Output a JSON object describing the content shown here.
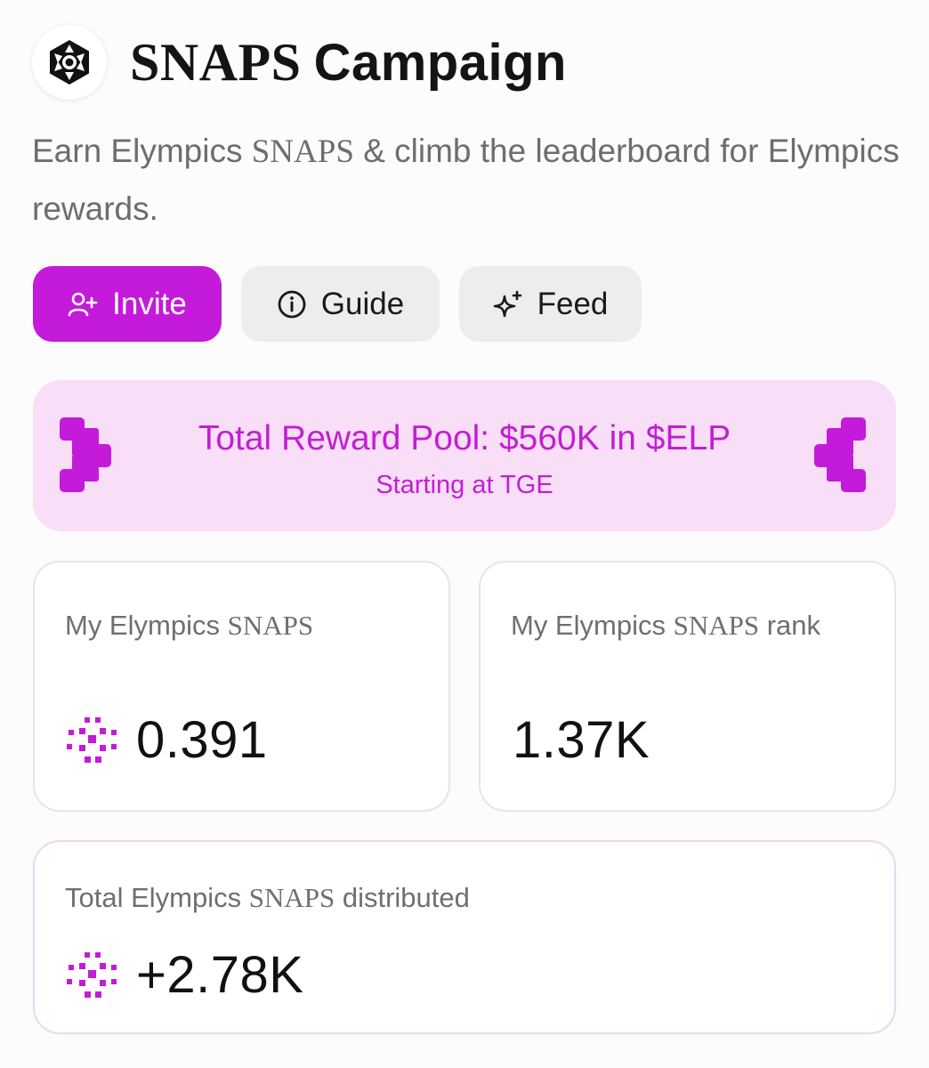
{
  "header": {
    "logo_icon": "elymphics-hex-logo-icon",
    "title_brand": "SNAPS",
    "title_rest": "Campaign"
  },
  "subtitle": {
    "part1": "Earn Elympics ",
    "brand": "SNAPS",
    "part2": " & climb the leaderboard for Elympics rewards."
  },
  "actions": {
    "invite": {
      "label": "Invite",
      "icon": "add-user-icon"
    },
    "guide": {
      "label": "Guide",
      "icon": "info-circle-icon"
    },
    "feed": {
      "label": "Feed",
      "icon": "sparkle-icon"
    }
  },
  "banner": {
    "title": "Total Reward Pool: $560K in $ELP",
    "subtitle": "Starting at TGE"
  },
  "stats": {
    "my_snaps": {
      "label_prefix": "My Elympics ",
      "label_brand": "SNAPS",
      "value": "0.391"
    },
    "my_rank": {
      "label_prefix": "My Elympics ",
      "label_brand": "SNAPS",
      "label_suffix": " rank",
      "value": "1.37K"
    },
    "total": {
      "label_prefix": "Total Elympics ",
      "label_brand": "SNAPS",
      "label_suffix": " distributed",
      "value": "+2.78K"
    }
  },
  "colors": {
    "accent": "#c41ad9",
    "banner_bg": "#f8def7",
    "banner_text": "#c21fd3",
    "chip_bg": "#ededed"
  }
}
